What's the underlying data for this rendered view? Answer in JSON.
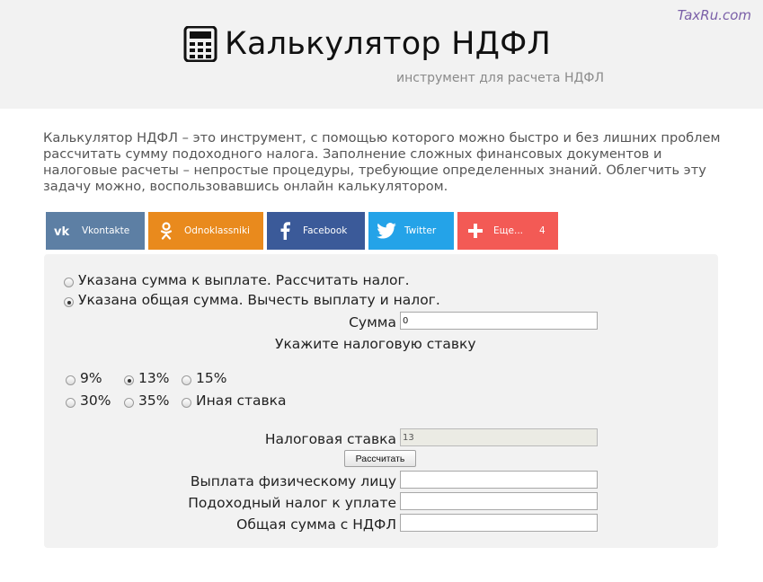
{
  "header": {
    "brand": "TaxRu.com",
    "title": "Калькулятор НДФЛ",
    "subtitle": "инструмент для расчета НДФЛ",
    "title_icon": "calculator-icon"
  },
  "intro": {
    "text": "Калькулятор НДФЛ – это инструмент, с помощью которого можно быстро и без лишних проблем рассчитать сумму подоходного налога. Заполнение сложных финансовых документов и налоговые расчеты – непростые процедуры, требующие определенных знаний. Облегчить эту задачу можно, воспользовавшись онлайн калькулятором."
  },
  "share": {
    "vk": {
      "label": "Vkontakte",
      "icon": "vk-icon",
      "color": "#5d7fa4"
    },
    "ok": {
      "label": "Odnoklassniki",
      "icon": "odnoklassniki-icon",
      "color": "#e98a1d"
    },
    "fb": {
      "label": "Facebook",
      "icon": "facebook-icon",
      "color": "#3b5a99"
    },
    "tw": {
      "label": "Twitter",
      "icon": "twitter-icon",
      "color": "#24a3e8"
    },
    "more": {
      "label": "Еще...",
      "count": "4",
      "icon": "plus-icon",
      "color": "#f35a55"
    }
  },
  "calculator": {
    "mode_options": [
      {
        "label": "Указана сумма к выплате. Рассчитать налог.",
        "checked": false
      },
      {
        "label": "Указана общая сумма. Вычесть выплату и налог.",
        "checked": true
      }
    ],
    "sum_label": "Сумма",
    "sum_value": "0",
    "rate_heading": "Укажите налоговую ставку",
    "rates": [
      {
        "label": "9%",
        "checked": false
      },
      {
        "label": "13%",
        "checked": true
      },
      {
        "label": "15%",
        "checked": false
      },
      {
        "label": "30%",
        "checked": false
      },
      {
        "label": "35%",
        "checked": false
      },
      {
        "label": "Иная ставка",
        "checked": false
      }
    ],
    "rate_field_label": "Налоговая ставка",
    "rate_field_value": "13",
    "calculate_button": "Рассчитать",
    "payout_label": "Выплата физическому лицу",
    "payout_value": "",
    "tax_label": "Подоходный налог к уплате",
    "tax_value": "",
    "total_label": "Общая сумма с НДФЛ",
    "total_value": ""
  }
}
